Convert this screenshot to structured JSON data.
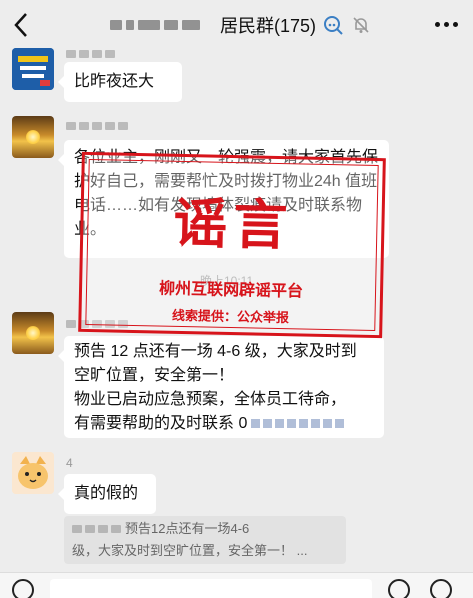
{
  "header": {
    "title": "居民群(175)",
    "back_icon": "chevron-left-icon",
    "search_icon": "search-icon",
    "mute_icon": "bell-off-icon",
    "more_icon": "more-icon"
  },
  "messages": [
    {
      "text": "比昨夜还大"
    },
    {
      "text": "各位业主，刚刚又一轮强震，请大家首先保护好自己，需要帮忙及时拨打物业24h 值班电话……如有发现墙体裂痕请及时联系物业。"
    },
    {
      "lines": [
        "预告 12 点还有一场 4-6 级，大家及时到",
        "空旷位置，安全第一！",
        "物业已启动应急预案，全体员工待命，",
        "有需要帮助的及时联系 0"
      ]
    },
    {
      "text": "真的假的",
      "sender": "4"
    }
  ],
  "time_label": "晚上10:11",
  "quote": {
    "line1": "预告12点还有一场4-6",
    "line2": "级，大家及时到空旷位置，安全第一！ ..."
  },
  "stamp": {
    "big": "谣言",
    "line1": "柳州互联网辟谣平台",
    "line2": "线索提供：公众举报",
    "color": "#d7141b"
  }
}
